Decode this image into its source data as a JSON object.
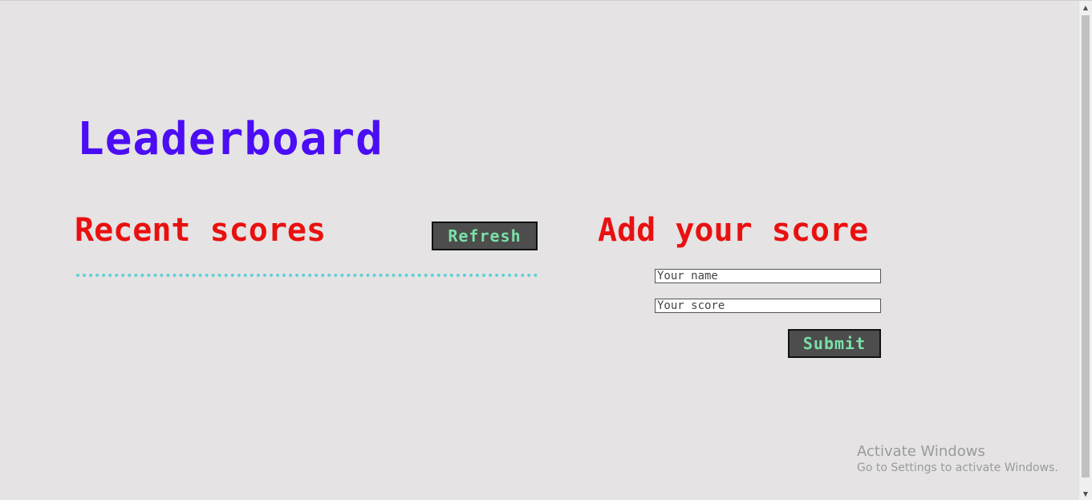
{
  "page": {
    "title": "Leaderboard"
  },
  "recent": {
    "heading": "Recent scores",
    "refresh_label": "Refresh",
    "scores": []
  },
  "add": {
    "heading": "Add your score",
    "name_placeholder": "Your name",
    "score_placeholder": "Your score",
    "submit_label": "Submit"
  },
  "watermark": {
    "title": "Activate Windows",
    "subtitle": "Go to Settings to activate Windows."
  },
  "colors": {
    "background": "#e5e3e3",
    "title": "#4a0df5",
    "heading": "#ea1010",
    "button_bg": "#4d4d4d",
    "button_text": "#7be0a8",
    "list_border": "#5fd0d8"
  }
}
